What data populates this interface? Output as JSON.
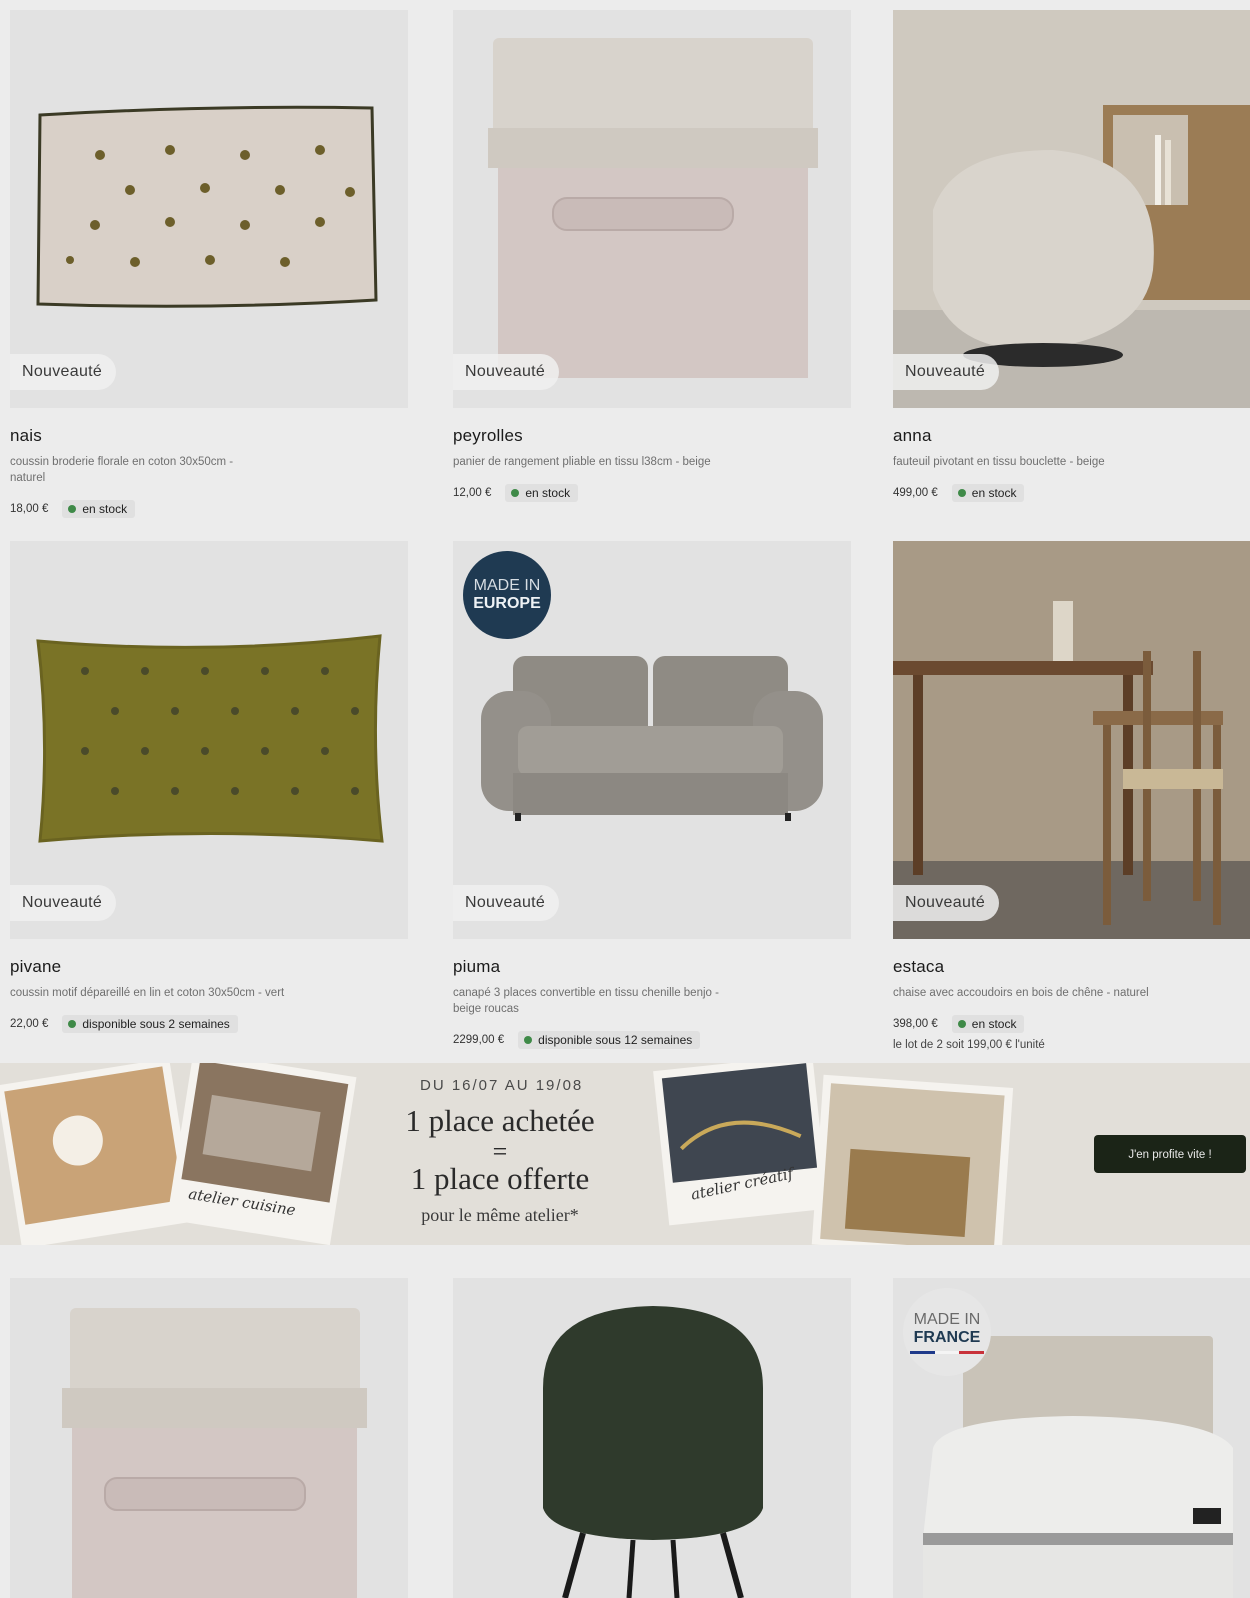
{
  "badge_new": "Nouveauté",
  "products": [
    {
      "name": "nais",
      "desc": "coussin broderie florale en coton 30x50cm - naturel",
      "price": "18,00 €",
      "availability": "en stock"
    },
    {
      "name": "peyrolles",
      "desc": "panier de rangement pliable en tissu l38cm - beige",
      "price": "12,00 €",
      "availability": "en stock"
    },
    {
      "name": "anna",
      "desc": "fauteuil pivotant en tissu bouclette - beige",
      "price": "499,00 €",
      "availability": "en stock"
    },
    {
      "name": "pivane",
      "desc": "coussin motif dépareillé en lin et coton 30x50cm - vert",
      "price": "22,00 €",
      "availability": "disponible sous 2 semaines"
    },
    {
      "name": "piuma",
      "desc": "canapé 3 places convertible en tissu chenille benjo - beige roucas",
      "price": "2299,00 €",
      "availability": "disponible sous 12 semaines",
      "origin": {
        "line1": "MADE IN",
        "line2": "EUROPE"
      }
    },
    {
      "name": "estaca",
      "desc": "chaise avec accoudoirs en bois de chêne - naturel",
      "price": "398,00 €",
      "availability": "en stock",
      "lot_note": "le lot de 2 soit 199,00 € l'unité"
    }
  ],
  "banner": {
    "date": "DU 16/07 AU 19/08",
    "line1": "1 place achetée",
    "equals": "=",
    "line2": "1 place offerte",
    "line3": "pour le même atelier*",
    "caption_left": "atelier cuisine",
    "caption_right": "atelier créatif",
    "cta": "J'en profite vite !"
  },
  "bottom_origin": {
    "line1": "MADE IN",
    "line2": "FRANCE"
  },
  "colors": {
    "stock_dot": "#3f8a48",
    "eu_badge": "#1f3a52",
    "cta_bg": "#1b2417",
    "flag": [
      "#1f3a8a",
      "#f4f4f4",
      "#c8323a"
    ]
  }
}
